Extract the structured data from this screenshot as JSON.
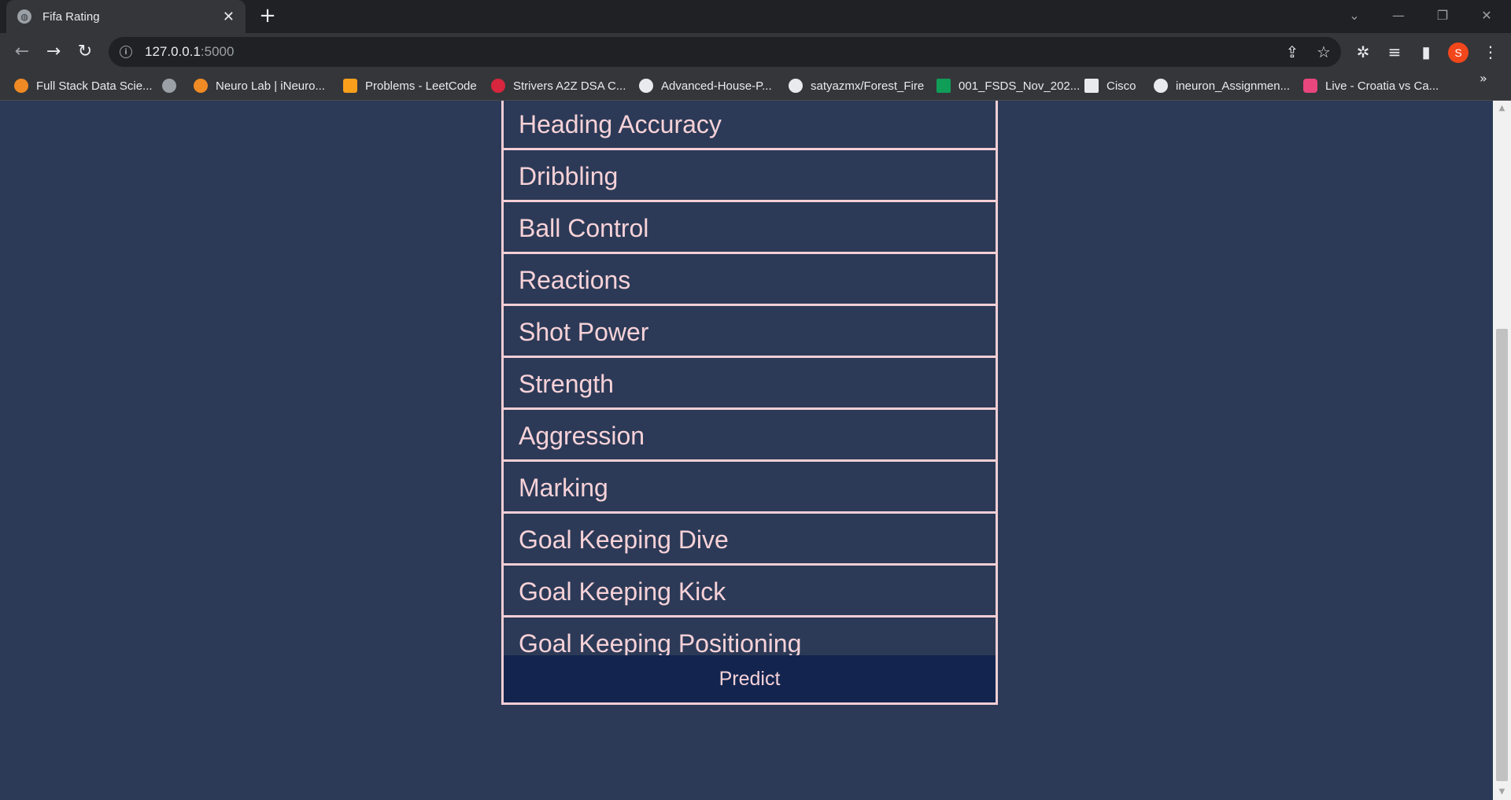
{
  "browser": {
    "tab": {
      "title": "Fifa Rating",
      "close_glyph": "✕",
      "favicon": "globe-icon"
    },
    "new_tab_glyph": "+",
    "window_controls": {
      "tab_search": "⌄",
      "minimize": "—",
      "restore": "❐",
      "close": "✕"
    },
    "nav": {
      "back": "←",
      "forward": "→",
      "reload": "↻"
    },
    "address": {
      "info_glyph": "i",
      "host": "127.0.0.1",
      "port": ":5000"
    },
    "omnibox_icons": {
      "share": "⇪",
      "bookmark_star": "☆"
    },
    "toolbar_icons": {
      "extensions": "✲",
      "reading_list": "≡",
      "side_panel": "▮",
      "menu": "⋮"
    },
    "profile_initial": "S",
    "bookmarks": [
      {
        "label": "Full Stack Data Scie...",
        "icon": "ineuron-icon",
        "color": "#f08a24"
      },
      {
        "label": "",
        "icon": "globe-icon",
        "color": "#9aa0a6"
      },
      {
        "label": "Neuro Lab | iNeuro...",
        "icon": "ineuron-icon",
        "color": "#f08a24"
      },
      {
        "label": "Problems - LeetCode",
        "icon": "leetcode-icon",
        "color": "#f89f1b"
      },
      {
        "label": "Strivers A2Z DSA C...",
        "icon": "takeuforward-icon",
        "color": "#d7263d"
      },
      {
        "label": "Advanced-House-P...",
        "icon": "github-icon",
        "color": "#e8eaed"
      },
      {
        "label": "satyazmx/Forest_Fire",
        "icon": "github-icon",
        "color": "#e8eaed"
      },
      {
        "label": "001_FSDS_Nov_202...",
        "icon": "google-sheets-icon",
        "color": "#0f9d58"
      },
      {
        "label": "Cisco",
        "icon": "cisco-icon",
        "color": "#e8eaed"
      },
      {
        "label": "ineuron_Assignmen...",
        "icon": "github-icon",
        "color": "#e8eaed"
      },
      {
        "label": "Live - Croatia vs Ca...",
        "icon": "live-tv-icon",
        "color": "#e8467c"
      }
    ],
    "bookmarks_overflow": "»"
  },
  "form": {
    "fields": [
      {
        "placeholder": "Heading Accuracy"
      },
      {
        "placeholder": "Dribbling"
      },
      {
        "placeholder": "Ball Control"
      },
      {
        "placeholder": "Reactions"
      },
      {
        "placeholder": "Shot Power"
      },
      {
        "placeholder": "Strength"
      },
      {
        "placeholder": "Aggression"
      },
      {
        "placeholder": "Marking"
      },
      {
        "placeholder": "Goal Keeping Dive"
      },
      {
        "placeholder": "Goal Keeping Kick"
      },
      {
        "placeholder": "Goal Keeping Positioning"
      }
    ],
    "submit_label": "Predict"
  },
  "scrollbar": {
    "up_glyph": "▲",
    "down_glyph": "▼"
  },
  "colors": {
    "page_background": "#2c3a57",
    "field_border": "#f5cfd5",
    "field_text": "#f7d2d8",
    "button_background": "#13254f",
    "profile_avatar": "#f2461b"
  }
}
